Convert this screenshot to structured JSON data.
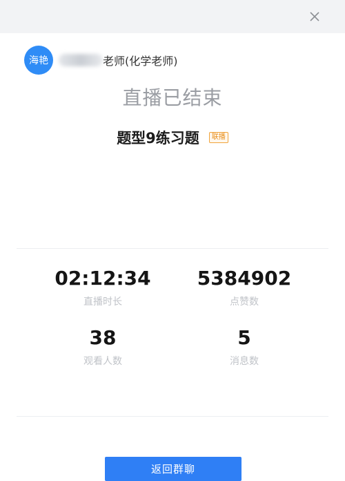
{
  "header": {
    "close_icon": "close-icon"
  },
  "teacher": {
    "avatar_text": "海艳",
    "name_visible": "老师(化学老师)",
    "accent_color": "#2f8cf6"
  },
  "live": {
    "status_text": "直播已结束",
    "course_title": "题型9练习题",
    "badge": "联播"
  },
  "stats": [
    {
      "value": "02:12:34",
      "label": "直播时长"
    },
    {
      "value": "5384902",
      "label": "点赞数"
    },
    {
      "value": "38",
      "label": "观看人数"
    },
    {
      "value": "5",
      "label": "消息数"
    }
  ],
  "actions": {
    "back_label": "返回群聊",
    "button_color": "#2f7ff5"
  }
}
